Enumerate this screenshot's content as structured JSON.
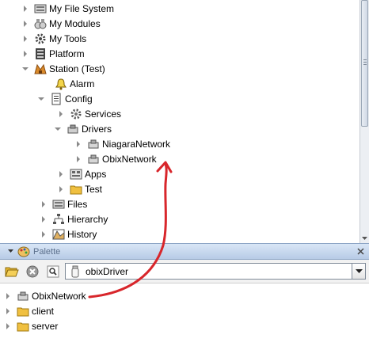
{
  "nav_tree": {
    "items": [
      {
        "label": "My File System",
        "icon": "file-system-icon",
        "expander": "right"
      },
      {
        "label": "My Modules",
        "icon": "modules-icon",
        "expander": "right"
      },
      {
        "label": "My Tools",
        "icon": "tools-icon",
        "expander": "right"
      },
      {
        "label": "Platform",
        "icon": "platform-icon",
        "expander": "right"
      },
      {
        "label": "Station (Test)",
        "icon": "station-icon",
        "expander": "down"
      },
      {
        "label": "Alarm",
        "icon": "alarm-bell-icon",
        "expander": "none"
      },
      {
        "label": "Config",
        "icon": "config-icon",
        "expander": "down"
      },
      {
        "label": "Services",
        "icon": "services-gear-icon",
        "expander": "right"
      },
      {
        "label": "Drivers",
        "icon": "drivers-icon",
        "expander": "down"
      },
      {
        "label": "NiagaraNetwork",
        "icon": "network-icon",
        "expander": "right"
      },
      {
        "label": "ObixNetwork",
        "icon": "network-icon",
        "expander": "right"
      },
      {
        "label": "Apps",
        "icon": "apps-icon",
        "expander": "right"
      },
      {
        "label": "Test",
        "icon": "folder-icon",
        "expander": "right"
      },
      {
        "label": "Files",
        "icon": "files-icon",
        "expander": "right"
      },
      {
        "label": "Hierarchy",
        "icon": "hierarchy-icon",
        "expander": "right"
      },
      {
        "label": "History",
        "icon": "history-icon",
        "expander": "right"
      }
    ]
  },
  "palette": {
    "title": "Palette",
    "module_selector": {
      "value": "obixDriver"
    },
    "items": [
      {
        "label": "ObixNetwork",
        "icon": "network-icon",
        "expander": "right"
      },
      {
        "label": "client",
        "icon": "folder-icon",
        "expander": "right"
      },
      {
        "label": "server",
        "icon": "folder-icon",
        "expander": "right"
      }
    ]
  },
  "colors": {
    "annotation_arrow": "#d8262b",
    "palette_header": "#c4d5ec",
    "folder": "#f0c040"
  }
}
